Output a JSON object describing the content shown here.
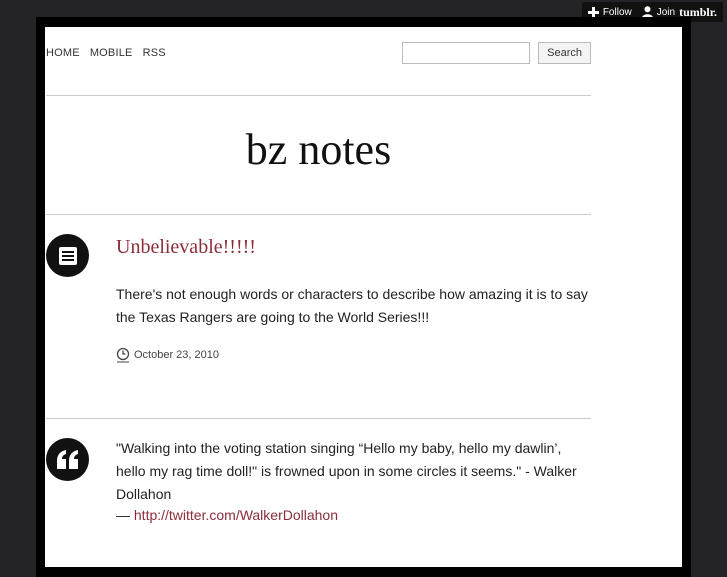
{
  "tumblr": {
    "follow_label": "Follow",
    "join_label": "Join",
    "brand": "tumblr."
  },
  "nav": {
    "items": [
      {
        "label": "HOME"
      },
      {
        "label": "MOBILE"
      },
      {
        "label": "RSS"
      }
    ],
    "search": {
      "value": "",
      "placeholder": "",
      "button_label": "Search"
    }
  },
  "blog": {
    "title": "bz notes"
  },
  "posts": [
    {
      "type": "text",
      "icon": "text-post-icon",
      "title": "Unbelievable!!!!!",
      "body": "There's not enough words or characters to describe how amazing it is to say the Texas Rangers are going to the World Series!!!",
      "date": "October 23, 2010"
    },
    {
      "type": "quote",
      "icon": "quote-post-icon",
      "quote": "\"Walking into the voting station singing “Hello my baby, hello my dawlin’, hello my rag time doll!\" is frowned upon in some circles it seems.\" - Walker Dollahon",
      "source_prefix": "— ",
      "source_link": "http://twitter.com/WalkerDollahon"
    }
  ],
  "colors": {
    "background": "#232328",
    "link": "#8a2e3a",
    "frame": "#000000"
  }
}
